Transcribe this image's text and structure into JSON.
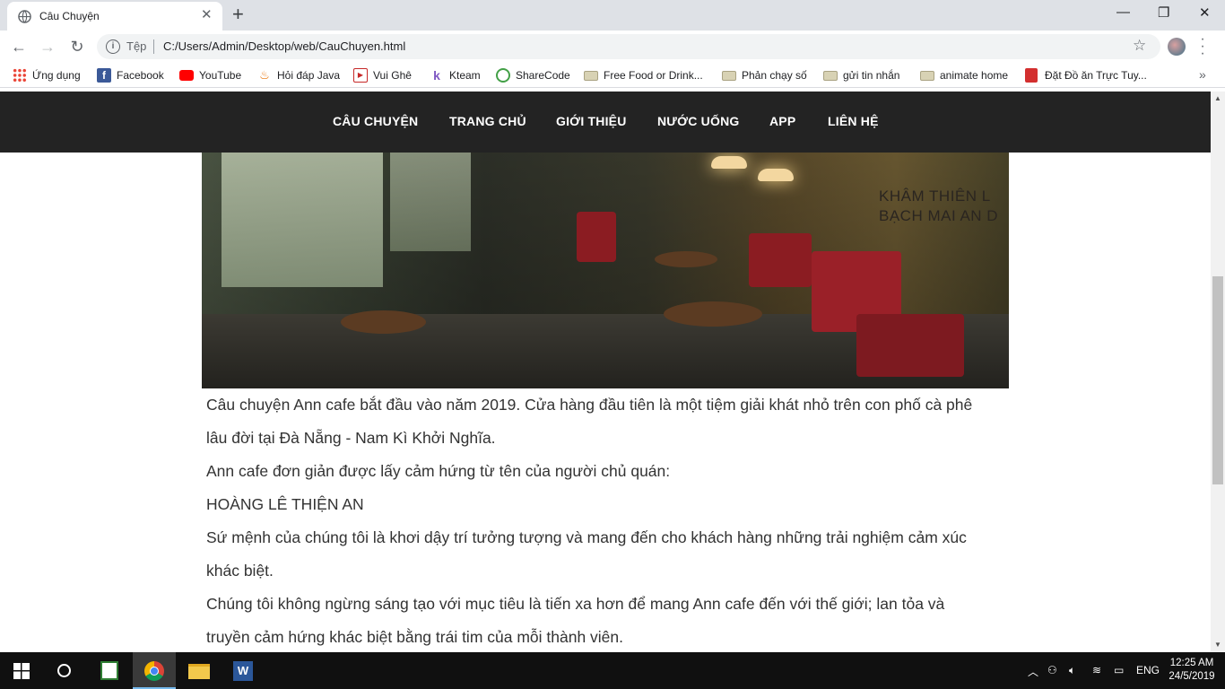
{
  "browser": {
    "tab": {
      "title": "Câu Chuyện"
    },
    "omnibox": {
      "scheme": "Tệp",
      "url": "C:/Users/Admin/Desktop/web/CauChuyen.html"
    },
    "bookmarks": [
      {
        "label": "Ứng dụng",
        "icon": "apps-grid-icon",
        "color": "#4285f4"
      },
      {
        "label": "Facebook",
        "icon": "facebook-icon",
        "color": "#3b5998"
      },
      {
        "label": "YouTube",
        "icon": "youtube-icon",
        "color": "#ff0000"
      },
      {
        "label": "Hỏi đáp Java",
        "icon": "java-icon",
        "color": "#e76f00"
      },
      {
        "label": "Vui Ghê",
        "icon": "play-icon",
        "color": "#c62828"
      },
      {
        "label": "Kteam",
        "icon": "kteam-icon",
        "color": "#7e57c2"
      },
      {
        "label": "ShareCode",
        "icon": "sharecode-icon",
        "color": "#43a047"
      },
      {
        "label": "Free Food or Drink...",
        "icon": "folder-icon",
        "color": "#cfc8a8"
      },
      {
        "label": "Phản chạy số",
        "icon": "folder-icon",
        "color": "#cfc8a8"
      },
      {
        "label": "gửi tin nhắn",
        "icon": "folder-icon",
        "color": "#cfc8a8"
      },
      {
        "label": "animate home",
        "icon": "folder-icon",
        "color": "#cfc8a8"
      },
      {
        "label": "Đặt Đồ ăn Trực Tuy...",
        "icon": "order-icon",
        "color": "#d32f2f"
      }
    ]
  },
  "site": {
    "nav": [
      "CÂU CHUYỆN",
      "TRANG CHỦ",
      "GIỚI THIỆU",
      "NƯỚC UỐNG",
      "APP",
      "LIÊN HỆ"
    ],
    "hero_wall_text": [
      "KHÂM THIÊN L",
      "BẠCH MAI AN D"
    ],
    "story": [
      "Câu chuyện Ann cafe bắt đầu vào năm 2019. Cửa hàng đầu tiên là một tiệm giải khát nhỏ trên con phố cà phê lâu đời tại Đà Nẵng - Nam Kì Khởi Nghĩa.",
      "Ann cafe đơn giản được lấy cảm hứng từ tên của người chủ quán:",
      "HOÀNG LÊ THIỆN AN",
      "Sứ mệnh của chúng tôi là khơi dậy trí tưởng tượng và mang đến cho khách hàng những trải nghiệm cảm xúc khác biệt.",
      "Chúng tôi không ngừng sáng tạo với mục tiêu là tiến xa hơn để mang Ann cafe đến với thế giới; lan tỏa và truyền cảm hứng khác biệt bằng trái tim của mỗi thành viên."
    ]
  },
  "taskbar": {
    "language": "ENG",
    "time": "12:25 AM",
    "date": "24/5/2019"
  }
}
